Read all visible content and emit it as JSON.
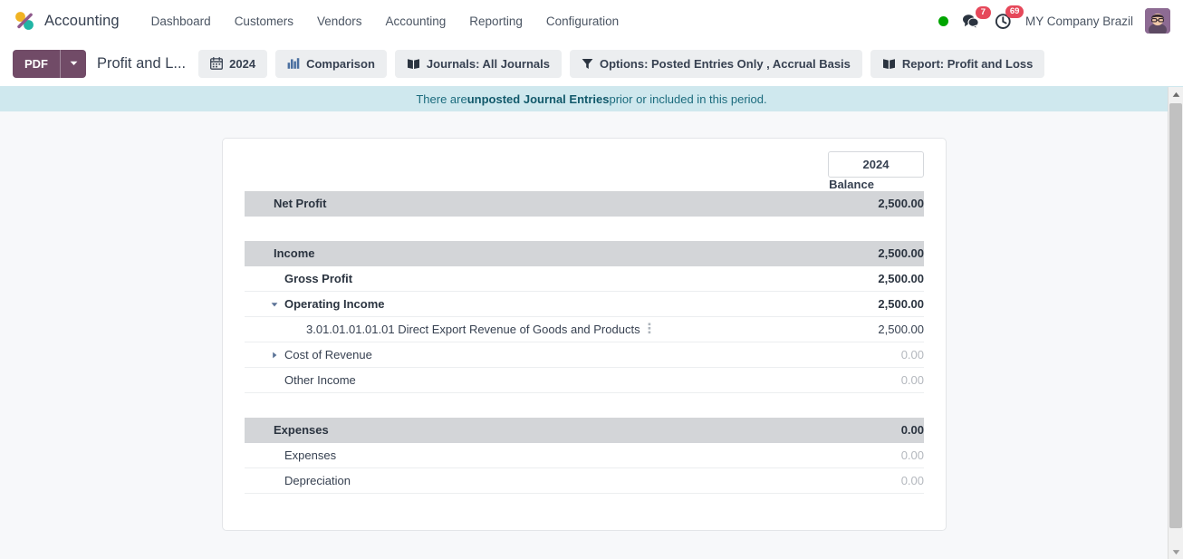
{
  "navbar": {
    "brand": "Accounting",
    "logo_colors": {
      "yellow": "#f0b323",
      "teal": "#21b5a5",
      "purple": "#8f5a8c"
    },
    "menu_items": [
      {
        "label": "Dashboard",
        "name": "menu-dashboard"
      },
      {
        "label": "Customers",
        "name": "menu-customers"
      },
      {
        "label": "Vendors",
        "name": "menu-vendors"
      },
      {
        "label": "Accounting",
        "name": "menu-accounting"
      },
      {
        "label": "Reporting",
        "name": "menu-reporting"
      },
      {
        "label": "Configuration",
        "name": "menu-configuration"
      }
    ],
    "status_color": "#00a500",
    "messages_badge": "7",
    "activities_badge": "69",
    "company": "MY Company Brazil"
  },
  "toolbar": {
    "pdf_label": "PDF",
    "pdf_color": "#714b67",
    "report_title": "Profit and L...",
    "chips": [
      {
        "name": "date-filter",
        "icon": "calendar-icon",
        "label": "2024"
      },
      {
        "name": "comparison-filter",
        "icon": "bar-chart-icon",
        "label": "Comparison"
      },
      {
        "name": "journals-filter",
        "icon": "book-icon",
        "label": "Journals: All Journals"
      },
      {
        "name": "options-filter",
        "icon": "filter-icon",
        "label": "Options: Posted Entries Only , Accrual Basis"
      },
      {
        "name": "report-selector",
        "icon": "book-icon",
        "label": "Report: Profit and Loss"
      }
    ]
  },
  "banner": {
    "prefix": "There are ",
    "strong": "unposted Journal Entries",
    "suffix": " prior or included in this period.",
    "background": "#cfe8ee"
  },
  "report": {
    "column_year": "2024",
    "column_label": "Balance",
    "rows": [
      {
        "label": "Net Profit",
        "value": "2,500.00",
        "style": "section",
        "indent": 0,
        "caret": "none",
        "muted": false,
        "dots": false
      },
      {
        "label": "",
        "value": "",
        "style": "spacer",
        "indent": 0,
        "caret": "none",
        "muted": false,
        "dots": false
      },
      {
        "label": "Income",
        "value": "2,500.00",
        "style": "section",
        "indent": 0,
        "caret": "none",
        "muted": false,
        "dots": false
      },
      {
        "label": "Gross Profit",
        "value": "2,500.00",
        "style": "bold",
        "indent": 1,
        "caret": "none",
        "muted": false,
        "dots": false
      },
      {
        "label": "Operating Income",
        "value": "2,500.00",
        "style": "bold",
        "indent": 2,
        "caret": "down",
        "muted": false,
        "dots": false
      },
      {
        "label": "3.01.01.01.01.01 Direct Export Revenue of Goods and Products",
        "value": "2,500.00",
        "style": "normal",
        "indent": 3,
        "caret": "none",
        "muted": false,
        "dots": true
      },
      {
        "label": "Cost of Revenue",
        "value": "0.00",
        "style": "normal",
        "indent": 2,
        "caret": "right",
        "muted": true,
        "dots": false
      },
      {
        "label": "Other Income",
        "value": "0.00",
        "style": "normal",
        "indent": 1,
        "caret": "none",
        "muted": true,
        "dots": false
      },
      {
        "label": "",
        "value": "",
        "style": "spacer",
        "indent": 0,
        "caret": "none",
        "muted": false,
        "dots": false
      },
      {
        "label": "Expenses",
        "value": "0.00",
        "style": "section",
        "indent": 0,
        "caret": "none",
        "muted": true,
        "dots": false
      },
      {
        "label": "Expenses",
        "value": "0.00",
        "style": "normal",
        "indent": 1,
        "caret": "none",
        "muted": true,
        "dots": false
      },
      {
        "label": "Depreciation",
        "value": "0.00",
        "style": "normal",
        "indent": 1,
        "caret": "none",
        "muted": true,
        "dots": false
      }
    ]
  }
}
